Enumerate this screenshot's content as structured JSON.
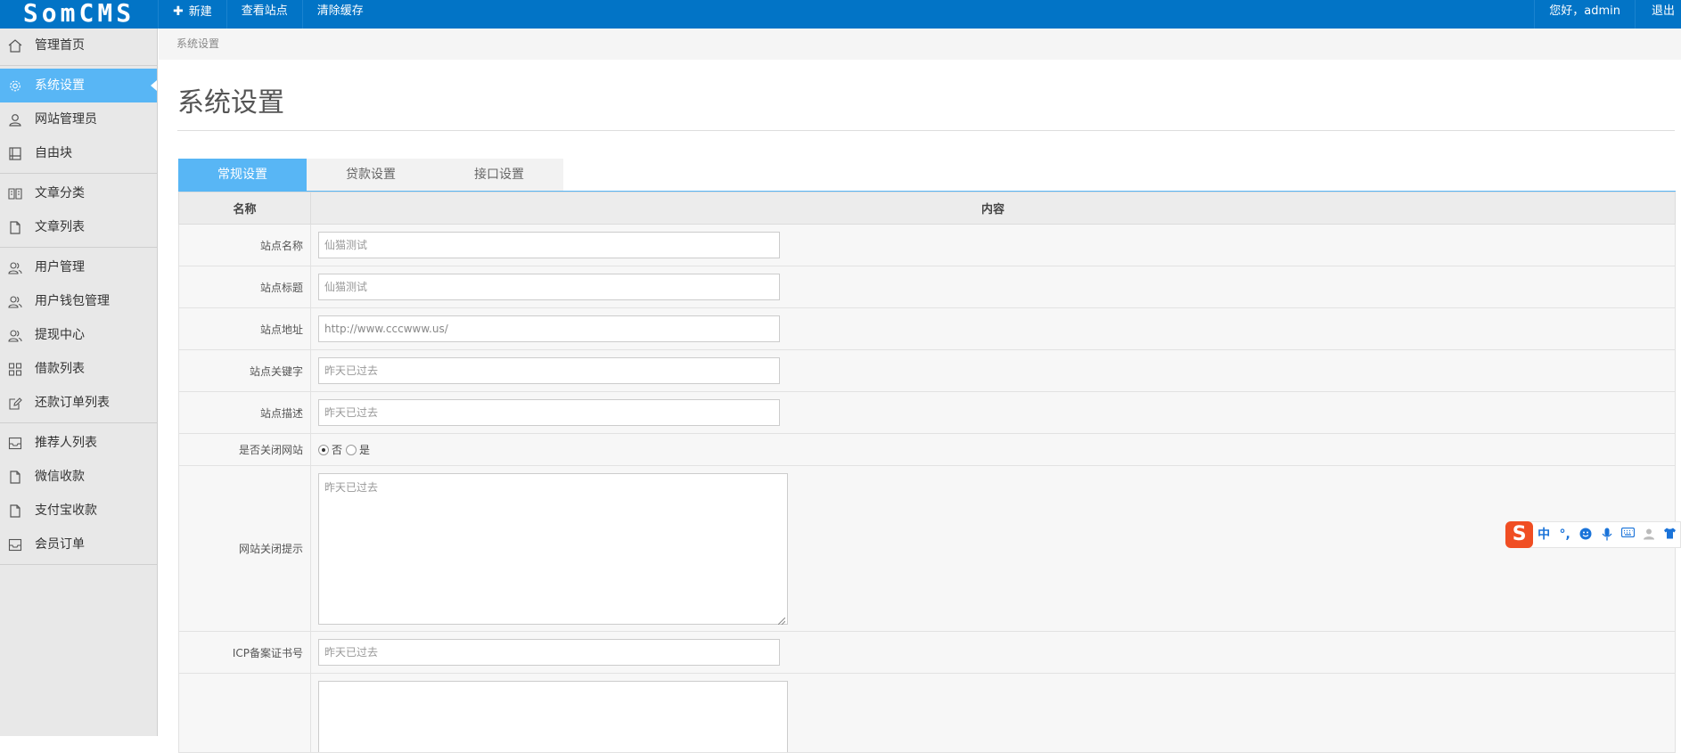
{
  "topbar": {
    "logo_text": "SomCMS",
    "new_label": "新建",
    "view_site_label": "查看站点",
    "clear_cache_label": "清除缓存",
    "greeting": "您好，admin",
    "logout_label": "退出"
  },
  "sidebar": {
    "groups": [
      [
        {
          "label": "管理首页",
          "icon": "home-icon"
        }
      ],
      [
        {
          "label": "系统设置",
          "icon": "gear-icon",
          "active": true
        },
        {
          "label": "网站管理员",
          "icon": "user-icon"
        },
        {
          "label": "自由块",
          "icon": "book-icon"
        }
      ],
      [
        {
          "label": "文章分类",
          "icon": "open-book-icon"
        },
        {
          "label": "文章列表",
          "icon": "document-icon"
        }
      ],
      [
        {
          "label": "用户管理",
          "icon": "users-icon"
        },
        {
          "label": "用户钱包管理",
          "icon": "users-icon"
        },
        {
          "label": "提现中心",
          "icon": "users-icon"
        },
        {
          "label": "借款列表",
          "icon": "grid-icon"
        },
        {
          "label": "还款订单列表",
          "icon": "edit-icon"
        }
      ],
      [
        {
          "label": "推荐人列表",
          "icon": "inbox-icon"
        },
        {
          "label": "微信收款",
          "icon": "document-icon"
        },
        {
          "label": "支付宝收款",
          "icon": "document-icon"
        },
        {
          "label": "会员订单",
          "icon": "inbox-icon"
        }
      ]
    ]
  },
  "main": {
    "breadcrumb": "系统设置",
    "page_title": "系统设置",
    "tabs": [
      "常规设置",
      "贷款设置",
      "接口设置"
    ],
    "active_tab": 0,
    "table": {
      "col_name": "名称",
      "col_content": "内容",
      "site_name": {
        "label": "站点名称",
        "value": "仙猫测试"
      },
      "site_title": {
        "label": "站点标题",
        "value": "仙猫测试"
      },
      "site_url": {
        "label": "站点地址",
        "value": "http://www.cccwww.us/"
      },
      "site_keywords": {
        "label": "站点关键字",
        "placeholder": "昨天已过去"
      },
      "site_desc": {
        "label": "站点描述",
        "placeholder": "昨天已过去"
      },
      "close_site": {
        "label": "是否关闭网站",
        "opt_no": "否",
        "opt_yes": "是",
        "selected": "否"
      },
      "close_tip": {
        "label": "网站关闭提示",
        "placeholder": "昨天已过去"
      },
      "icp": {
        "label": "ICP备案证书号",
        "placeholder": "昨天已过去"
      }
    }
  },
  "ime": {
    "logo": "S",
    "mode": "中",
    "punct": "°,"
  },
  "colors": {
    "topbar": "#0274c6",
    "accent": "#58b6f5",
    "sidebar_bg": "#e8e8e8",
    "ime_brand": "#f04e23"
  }
}
